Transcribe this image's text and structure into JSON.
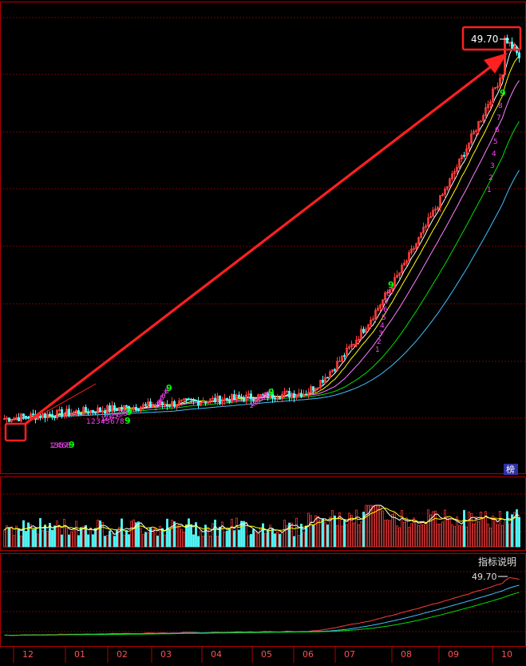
{
  "chart_data": [
    {
      "type": "candlestick",
      "panel": "price",
      "series": [
        {
          "name": "",
          "values": []
        }
      ],
      "peak_price": "49.70",
      "peak_value": 49.7,
      "start_price_approx": 3.2,
      "close_approx": 41.5,
      "annotation": {
        "type": "arrow",
        "from": "12",
        "to": "10"
      },
      "tag_label": "榜",
      "td_counts": [
        {
          "month": "12",
          "seq": [
            "1",
            "2",
            "3",
            "4",
            "5",
            "6",
            "7",
            "8",
            "9"
          ],
          "side": "buy"
        },
        {
          "month": "01",
          "seq": [
            "1",
            "2",
            "3",
            "4",
            "5",
            "6",
            "7",
            "8",
            "9"
          ],
          "side": "sell"
        },
        {
          "month": "02",
          "seq": [
            "1",
            "2",
            "3",
            "4",
            "5",
            "6",
            "7",
            "8",
            "9"
          ],
          "side": "sell"
        },
        {
          "month": "03",
          "seq": [
            "1",
            "2",
            "3",
            "4",
            "5",
            "6",
            "7",
            "8",
            "9"
          ],
          "side": "sell"
        },
        {
          "month": "05",
          "seq": [
            "1",
            "2",
            "3",
            "4",
            "5",
            "6",
            "7",
            "8",
            "9"
          ],
          "side": "sell"
        },
        {
          "month": "07",
          "seq": [
            "1",
            "2",
            "3",
            "4",
            "5",
            "6",
            "7",
            "8",
            "9"
          ],
          "side": "sell"
        },
        {
          "month": "09",
          "seq": [
            "1",
            "2",
            "3",
            "4",
            "5",
            "6",
            "7",
            "8",
            "9"
          ],
          "side": "sell"
        }
      ],
      "grid": true,
      "scale": "log"
    },
    {
      "type": "bar",
      "panel": "volume",
      "grid": true
    },
    {
      "type": "line",
      "panel": "indicator",
      "title": "指标说明",
      "peak_value": "49.70",
      "grid": true
    }
  ],
  "x_axis": {
    "ticks": [
      "12",
      "01",
      "02",
      "03",
      "04",
      "05",
      "06",
      "07",
      "08",
      "09",
      "10"
    ]
  },
  "colors": {
    "background": "#000000",
    "up": "#ff3c3c",
    "down": "#54fcfc",
    "grid": "#7a0000",
    "frame": "#b00000",
    "annotation": "#ff2020",
    "ma5": "#ffffff",
    "ma10": "#ffff00",
    "ma20": "#ff80ff",
    "ma30": "#00e000",
    "ma60": "#40c0ff",
    "td_buy": "#ff40ff",
    "td_sell": "#ff40ff",
    "td_nine": "#00ff00",
    "axis_text": "#ff5050"
  }
}
